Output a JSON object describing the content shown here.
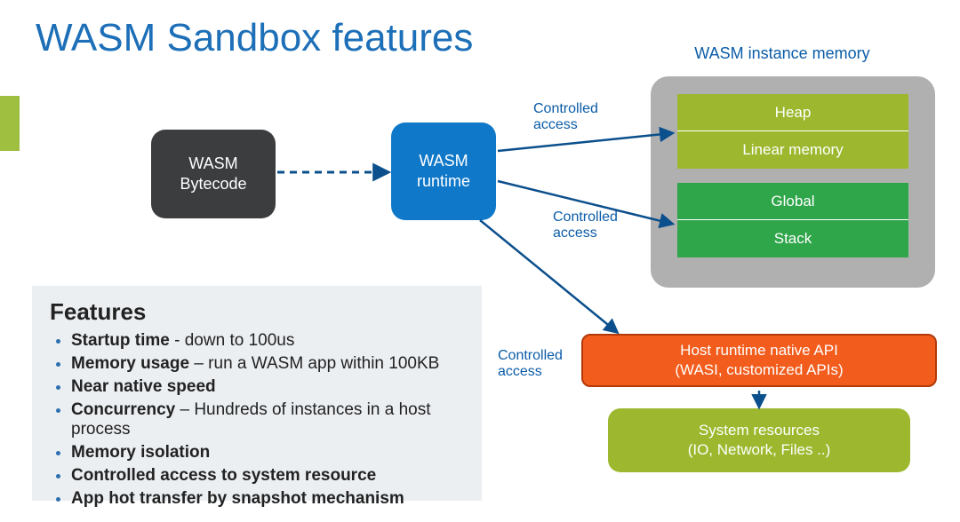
{
  "title": "WASM Sandbox features",
  "memory_label": "WASM instance memory",
  "boxes": {
    "bytecode": "WASM\nBytecode",
    "runtime": "WASM\nruntime",
    "heap": "Heap",
    "linear": "Linear memory",
    "global": "Global",
    "stack": "Stack",
    "hostapi_line1": "Host runtime native API",
    "hostapi_line2": "(WASI,  customized APIs)",
    "sysres_line1": "System resources",
    "sysres_line2": "(IO, Network, Files ..)"
  },
  "controlled": {
    "l1a": "Controlled",
    "l1b": "access",
    "l2a": "Controlled",
    "l2b": "access",
    "l3a": "Controlled",
    "l3b": "access"
  },
  "features": {
    "heading": "Features",
    "items": [
      {
        "b": "Startup time",
        "rest": "  -  down to 100us"
      },
      {
        "b": "Memory usage",
        "rest": " – run a WASM app within 100KB"
      },
      {
        "b": "Near native speed",
        "rest": ""
      },
      {
        "b": "Concurrency",
        "rest": " – Hundreds of instances in a host process"
      },
      {
        "b": "Memory isolation",
        "rest": ""
      },
      {
        "b": "Controlled access to system resource",
        "rest": ""
      },
      {
        "b": "App hot transfer by snapshot mechanism",
        "rest": ""
      }
    ]
  }
}
